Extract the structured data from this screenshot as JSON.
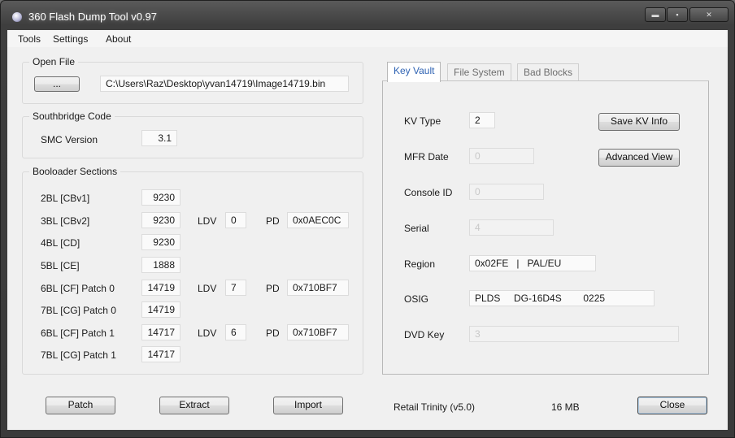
{
  "window": {
    "title": "360 Flash Dump Tool  v0.97",
    "controls": {
      "min": "▬",
      "max": "▪",
      "close": "✕"
    }
  },
  "menu": {
    "items": [
      "Tools",
      "Settings",
      "About"
    ]
  },
  "open_file": {
    "title": "Open File",
    "browse_label": "...",
    "path": "C:\\Users\\Raz\\Desktop\\yvan14719\\Image14719.bin"
  },
  "southbridge": {
    "title": "Southbridge Code",
    "smc_label": "SMC Version",
    "smc_value": "3.1"
  },
  "bootloader": {
    "title": "Booloader Sections",
    "ldv_label": "LDV",
    "pd_label": "PD",
    "rows": [
      {
        "label": "2BL [CBv1]",
        "value": "9230"
      },
      {
        "label": "3BL [CBv2]",
        "value": "9230",
        "ldv": "0",
        "pd": "0x0AEC0C"
      },
      {
        "label": "4BL [CD]",
        "value": "9230"
      },
      {
        "label": "5BL [CE]",
        "value": "1888"
      },
      {
        "label": "6BL [CF] Patch 0",
        "value": "14719",
        "ldv": "7",
        "pd": "0x710BF7"
      },
      {
        "label": "7BL [CG] Patch 0",
        "value": "14719"
      },
      {
        "label": "6BL [CF] Patch 1",
        "value": "14717",
        "ldv": "6",
        "pd": "0x710BF7"
      },
      {
        "label": "7BL [CG] Patch 1",
        "value": "14717"
      }
    ]
  },
  "tabs": [
    {
      "label": "Key Vault",
      "active": true
    },
    {
      "label": "File System",
      "active": false
    },
    {
      "label": "Bad Blocks",
      "active": false
    }
  ],
  "keyvault": {
    "kv_type_label": "KV Type",
    "kv_type": "2",
    "mfr_date_label": "MFR Date",
    "mfr_date": "0",
    "console_id_label": "Console ID",
    "console_id": "0",
    "serial_label": "Serial",
    "serial": "4",
    "region_label": "Region",
    "region": "0x02FE   |   PAL/EU",
    "osig_label": "OSIG",
    "osig": "PLDS     DG-16D4S        0225",
    "dvd_key_label": "DVD Key",
    "dvd_key": "3",
    "save_kv_label": "Save KV Info",
    "advanced_view_label": "Advanced View"
  },
  "actions": {
    "patch": "Patch",
    "extract": "Extract",
    "import": "Import",
    "close": "Close"
  },
  "status": {
    "console_type": "Retail Trinity (v5.0)",
    "size": "16 MB"
  },
  "colors": {
    "active_tab_text": "#2f63b3",
    "window_frame": "#3a3a3a"
  }
}
